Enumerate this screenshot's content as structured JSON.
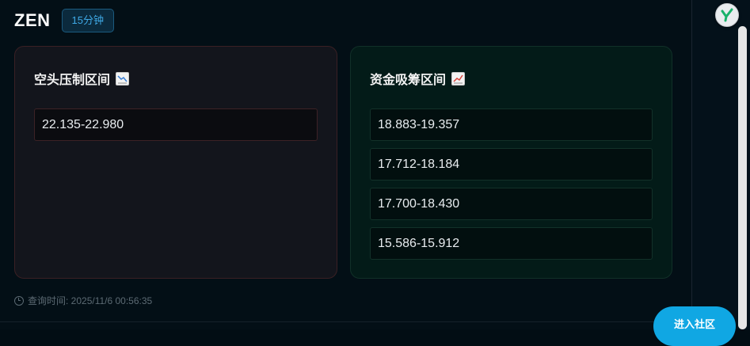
{
  "header": {
    "symbol": "ZEN",
    "timeframe": "15分钟"
  },
  "short_card": {
    "title": "空头压制区间",
    "icon": "chart-decreasing-icon",
    "ranges": [
      "22.135-22.980"
    ]
  },
  "long_card": {
    "title": "资金吸筹区间",
    "icon": "chart-increasing-icon",
    "ranges": [
      "18.883-19.357",
      "17.712-18.184",
      "17.700-18.430",
      "15.586-15.912"
    ]
  },
  "footer": {
    "query_time": "查询时间: 2025/11/6 00:56:35"
  },
  "community_button": {
    "label": "进入社区"
  },
  "colors": {
    "accent": "#10a7e3",
    "short_border": "#3a2024",
    "long_border": "#113028"
  }
}
